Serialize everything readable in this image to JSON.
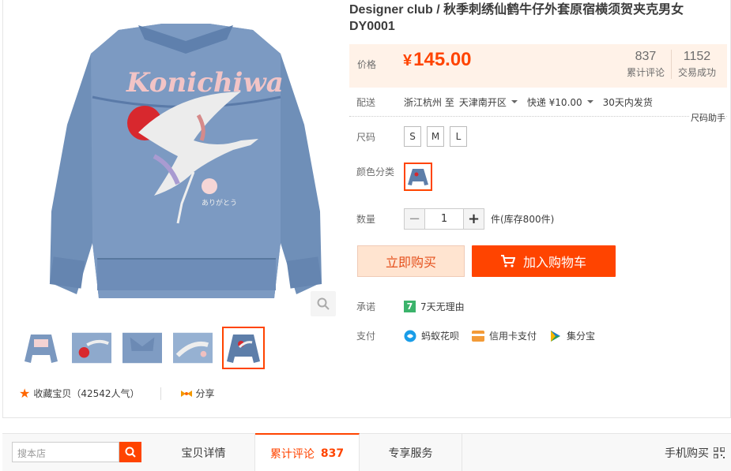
{
  "title": "Designer club / 秋季刺绣仙鹤牛仔外套原宿横须贺夹克男女DY0001",
  "price": {
    "label": "价格",
    "currency": "¥",
    "value": "145.00"
  },
  "stats": [
    {
      "num": "837",
      "label": "累计评论"
    },
    {
      "num": "1152",
      "label": "交易成功"
    }
  ],
  "shipping": {
    "label": "配送",
    "from": "浙江杭州 至",
    "to": "天津南开区",
    "method": "快递 ¥10.00",
    "time": "30天内发货"
  },
  "size_help": "尺码助手",
  "size": {
    "label": "尺码",
    "options": [
      "S",
      "M",
      "L"
    ]
  },
  "color": {
    "label": "颜色分类"
  },
  "quantity": {
    "label": "数量",
    "minus": "−",
    "value": "1",
    "plus": "+",
    "stock": "件(库存800件)"
  },
  "buttons": {
    "buy_now": "立即购买",
    "add_cart": "加入购物车"
  },
  "promise": {
    "label": "承诺",
    "badge": "7",
    "text": "7天无理由"
  },
  "payment": {
    "label": "支付",
    "methods": [
      "蚂蚁花呗",
      "信用卡支付",
      "集分宝"
    ]
  },
  "favorite": {
    "star": "★",
    "text": "收藏宝贝（42542人气）",
    "share": "分享"
  },
  "tabbar": {
    "search_placeholder": "搜本店",
    "tabs": [
      "宝贝详情",
      "累计评论",
      "专享服务"
    ],
    "review_count": "837",
    "mobile_buy": "手机购买"
  },
  "colors": {
    "accent": "#ff4400",
    "price_bg": "#fff2e8",
    "promise_green": "#3bb36b"
  }
}
